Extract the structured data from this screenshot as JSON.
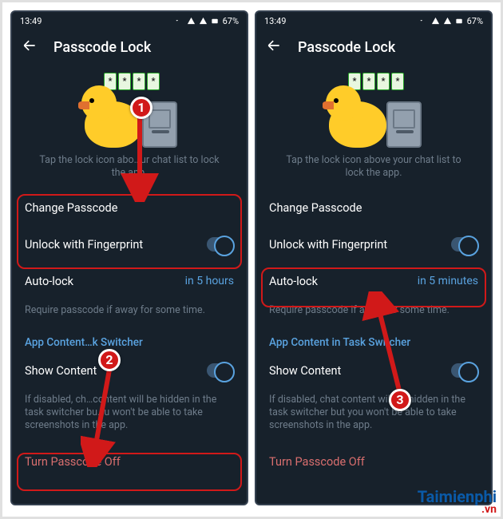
{
  "status": {
    "time": "13:49",
    "battery": "67%"
  },
  "header": {
    "title": "Passcode Lock"
  },
  "hero": {
    "hint_left": "Tap the lock icon abo…ur chat list to lock the app.",
    "hint_right": "Tap the lock icon above your chat list to lock the app."
  },
  "rows": {
    "change_passcode": "Change Passcode",
    "unlock_fp": "Unlock with Fingerprint",
    "autolock": "Auto-lock",
    "autolock_val_left": "in 5 hours",
    "autolock_val_right": "in 5 minutes",
    "require_hint": "Require passcode if away for some time.",
    "section_left": "App Content…k Switcher",
    "section_right": "App Content in Task Switcher",
    "show_content": "Show Content",
    "disabled_hint_left": "If disabled, ch…content will be hidden in the task switcher bu…u won't be able to take screenshots in the app.",
    "disabled_hint_right": "If disabled, chat content will be hidden in the task switcher but you won't be able to take screenshots in the app.",
    "turn_off": "Turn Passcode Off"
  },
  "annotations": {
    "b1": "1",
    "b2": "2",
    "b3": "3"
  },
  "watermark": {
    "brand_first": "T",
    "brand_rest": "aimienphi",
    "domain": ".vn"
  }
}
